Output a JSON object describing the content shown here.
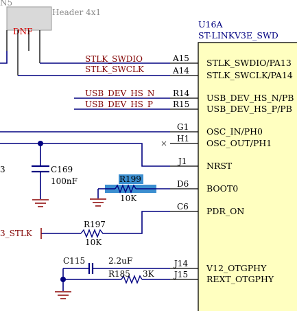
{
  "header": {
    "ref_partial": "N5",
    "label": "Header 4x1",
    "dnf": "DNF"
  },
  "ic": {
    "ref": "U16A",
    "part": "ST-LINKV3E_SWD",
    "body_color": "#ffffc0"
  },
  "pins": [
    {
      "number": "A15",
      "name": "STLK_SWDIO/PA13"
    },
    {
      "number": "A14",
      "name": "STLK_SWCLK/PA14"
    },
    {
      "number": "R14",
      "name": "USB_DEV_HS_N/PB"
    },
    {
      "number": "R15",
      "name": "USB_DEV_HS_P/PB"
    },
    {
      "number": "G1",
      "name": "OSC_IN/PH0"
    },
    {
      "number": "H1",
      "name": "OSC_OUT/PH1"
    },
    {
      "number": "J1",
      "name": "NRST"
    },
    {
      "number": "D6",
      "name": "BOOT0"
    },
    {
      "number": "C6",
      "name": "PDR_ON"
    },
    {
      "number": "J14",
      "name": "V12_OTGPHY"
    },
    {
      "number": "J15",
      "name": "REXT_OTGPHY"
    }
  ],
  "nets": {
    "swdio": "STLK_SWDIO",
    "swclk": "STLK_SWCLK",
    "usb_n": "USB_DEV_HS_N",
    "usb_p": "USB_DEV_HS_P",
    "stlk_partial": "3_STLK",
    "left_partial": "3"
  },
  "components": {
    "c169": {
      "ref": "C169",
      "value": "100nF"
    },
    "r199": {
      "ref": "R199",
      "value": "10K"
    },
    "r197": {
      "ref": "R197",
      "value": "10K"
    },
    "c115": {
      "ref": "C115",
      "value": "2.2uF"
    },
    "r185": {
      "ref": "R185",
      "value": "3K"
    }
  },
  "colors": {
    "wire": "#000080",
    "net_label": "#800000",
    "dnf": "#d40000",
    "header_fill": "#d9d9d9",
    "selection": "#3c8fd0"
  }
}
